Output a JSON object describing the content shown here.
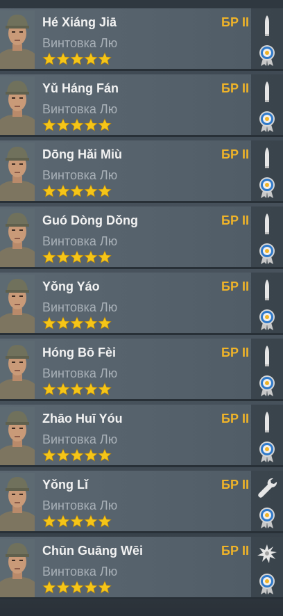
{
  "soldiers": [
    {
      "name": "Hé Xiáng Jiā",
      "weapon": "Винтовка Лю",
      "br": "БР II",
      "stars": 5,
      "class_icon": "bullet-icon",
      "award_icon": "medal-icon"
    },
    {
      "name": "Yǔ Háng Fán",
      "weapon": "Винтовка Лю",
      "br": "БР II",
      "stars": 5,
      "class_icon": "bullet-icon",
      "award_icon": "medal-icon"
    },
    {
      "name": "Dōng Hǎi Miù",
      "weapon": "Винтовка Лю",
      "br": "БР II",
      "stars": 5,
      "class_icon": "bullet-icon",
      "award_icon": "medal-icon"
    },
    {
      "name": "Guó Dòng Dǒng",
      "weapon": "Винтовка Лю",
      "br": "БР II",
      "stars": 5,
      "class_icon": "bullet-icon",
      "award_icon": "medal-icon"
    },
    {
      "name": "Yǒng Yáo",
      "weapon": "Винтовка Лю",
      "br": "БР II",
      "stars": 5,
      "class_icon": "bullet-icon",
      "award_icon": "medal-icon"
    },
    {
      "name": "Hóng Bō Fèi",
      "weapon": "Винтовка Лю",
      "br": "БР II",
      "stars": 5,
      "class_icon": "bullet-icon",
      "award_icon": "medal-icon"
    },
    {
      "name": "Zhāo Huī Yóu",
      "weapon": "Винтовка Лю",
      "br": "БР II",
      "stars": 5,
      "class_icon": "bullet-icon",
      "award_icon": "medal-icon"
    },
    {
      "name": "Yǒng Lǐ",
      "weapon": "Винтовка Лю",
      "br": "БР II",
      "stars": 5,
      "class_icon": "wrench-icon",
      "award_icon": "medal-icon"
    },
    {
      "name": "Chūn Guāng Wēi",
      "weapon": "Винтовка Лю",
      "br": "БР II",
      "stars": 5,
      "class_icon": "explosion-icon",
      "award_icon": "medal-icon"
    }
  ],
  "colors": {
    "name": "#f2f2f2",
    "weapon": "#a9b1b8",
    "br": "#f0b429",
    "star": "#f5c518",
    "card": "#56626c"
  }
}
